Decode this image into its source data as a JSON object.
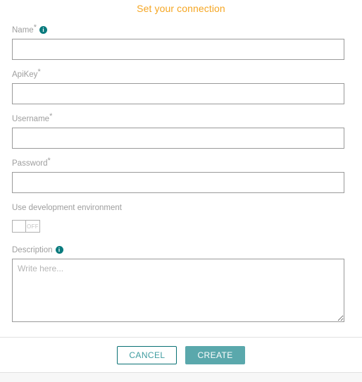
{
  "dialog": {
    "title": "Set your connection",
    "title_color": "#f5a623"
  },
  "fields": {
    "name": {
      "label": "Name",
      "required_marker": "*",
      "info_icon": "info-icon",
      "value": "",
      "placeholder": ""
    },
    "apikey": {
      "label": "ApiKey",
      "required_marker": "*",
      "value": "",
      "placeholder": ""
    },
    "username": {
      "label": "Username",
      "required_marker": "*",
      "value": "",
      "placeholder": ""
    },
    "password": {
      "label": "Password",
      "required_marker": "*",
      "value": "",
      "placeholder": ""
    },
    "dev_environment": {
      "label": "Use development environment",
      "toggle_state": "OFF"
    },
    "description": {
      "label": "Description",
      "info_icon": "info-icon",
      "value": "",
      "placeholder": "Write here..."
    }
  },
  "footer": {
    "cancel_label": "CANCEL",
    "create_label": "CREATE",
    "cancel_color": "#0a7175",
    "create_color": "#5aa8ac"
  }
}
